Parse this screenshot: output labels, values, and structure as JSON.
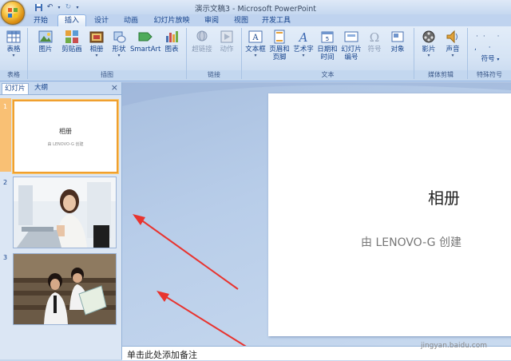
{
  "window": {
    "title": "演示文稿3 - Microsoft PowerPoint"
  },
  "tabs": [
    {
      "label": "开始"
    },
    {
      "label": "插入"
    },
    {
      "label": "设计"
    },
    {
      "label": "动画"
    },
    {
      "label": "幻灯片放映"
    },
    {
      "label": "审阅"
    },
    {
      "label": "视图"
    },
    {
      "label": "开发工具"
    }
  ],
  "ribbon": {
    "groups": {
      "tables": "表格",
      "illustrations": "插图",
      "links": "链接",
      "text": "文本",
      "media": "媒体剪辑",
      "symbols": "特殊符号"
    },
    "buttons": {
      "table": "表格",
      "picture": "图片",
      "clipart": "剪贴画",
      "album": "相册",
      "shapes": "形状",
      "smartart": "SmartArt",
      "chart": "图表",
      "hyperlink": "超链接",
      "action": "动作",
      "textbox": "文本框",
      "header_footer_1": "页眉和",
      "header_footer_2": "页脚",
      "wordart": "艺术字",
      "datetime_1": "日期和",
      "datetime_2": "时间",
      "slidenum_1": "幻灯片",
      "slidenum_2": "编号",
      "symbol": "符号",
      "object": "对象",
      "movie": "影片",
      "sound": "声音",
      "special_symbol": "符号"
    }
  },
  "pane": {
    "tab_slides": "幻灯片",
    "tab_outline": "大纲",
    "close": "×",
    "thumbs": [
      {
        "num": "1",
        "title": "相册",
        "subtitle": "由 LENOVO-G 创建"
      },
      {
        "num": "2"
      },
      {
        "num": "3"
      }
    ]
  },
  "slide": {
    "title": "相册",
    "subtitle": "由 LENOVO-G 创建"
  },
  "notes": {
    "placeholder": "单击此处添加备注"
  },
  "watermark": "jingyan.baidu.com",
  "colors": {
    "ribbon_text": "#15428b",
    "selection": "#f0a030",
    "arrow": "#e8342f"
  }
}
